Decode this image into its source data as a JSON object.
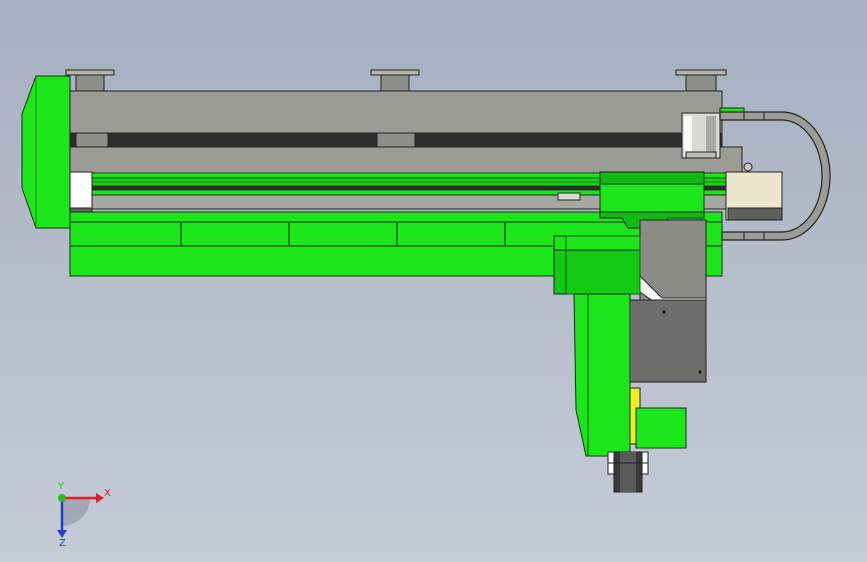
{
  "viewport": {
    "background_top": "#a5afc1",
    "background_bottom": "#c6ccd6"
  },
  "model": {
    "accent_green": "#1ae61a",
    "steel_gray": "#9c9c96",
    "dark_gray": "#6d6d6a",
    "cream": "#eee5cf",
    "yellow": "#f2ee1f"
  },
  "triad": {
    "x_label": "X",
    "y_label": "Y",
    "z_label": "Z",
    "x_color": "#e02020",
    "y_color": "#20c020",
    "z_color": "#2040d0"
  }
}
